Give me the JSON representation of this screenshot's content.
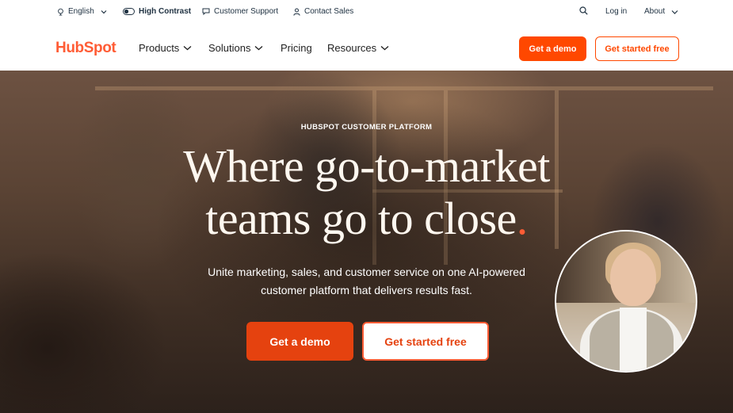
{
  "utility": {
    "language": "English",
    "contrast": "High Contrast",
    "support": "Customer Support",
    "sales": "Contact Sales",
    "login": "Log in",
    "about": "About"
  },
  "nav": {
    "logo": "HubSpot",
    "products": "Products",
    "solutions": "Solutions",
    "pricing": "Pricing",
    "resources": "Resources",
    "demo": "Get a demo",
    "free": "Get started free"
  },
  "hero": {
    "eyebrow": "HUBSPOT CUSTOMER PLATFORM",
    "headline_line1": "Where go-to-market",
    "headline_line2": "teams go to close",
    "headline_dot": ".",
    "sub_line1": "Unite marketing, sales, and customer service on one AI-powered",
    "sub_line2": "customer platform that delivers results fast.",
    "demo": "Get a demo",
    "free": "Get started free"
  },
  "colors": {
    "brand_orange": "#ff4800",
    "logo_orange": "#ff5c35"
  }
}
